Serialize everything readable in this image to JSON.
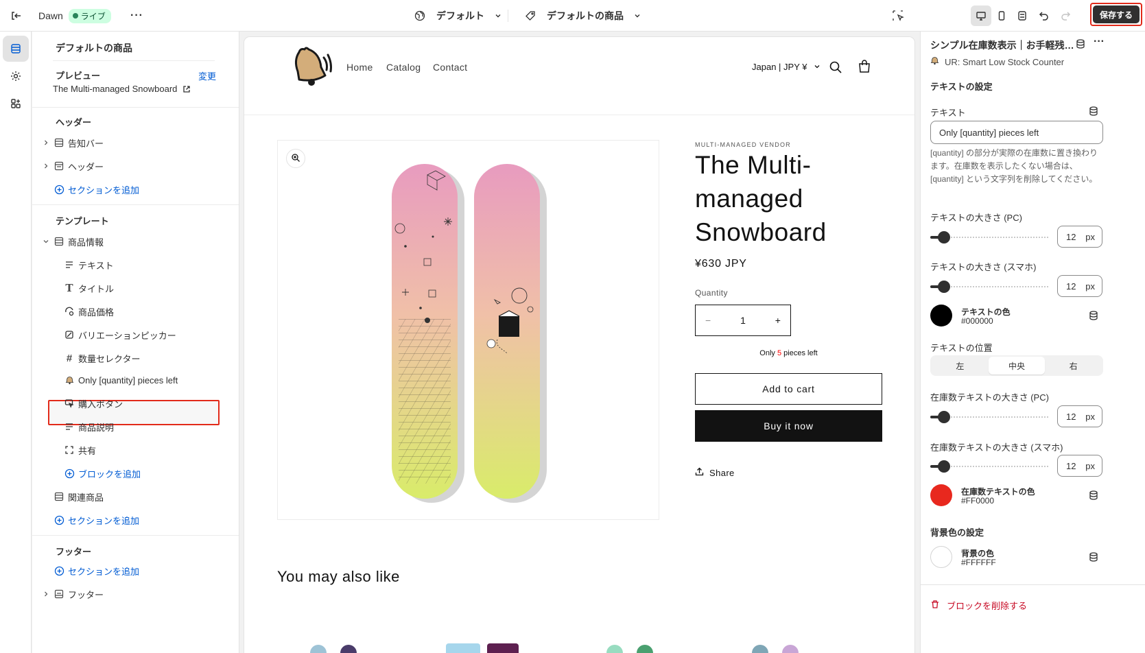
{
  "topbar": {
    "theme_name": "Dawn",
    "live_badge": "ライブ",
    "more_label": "···",
    "context_default": "デフォルト",
    "context_template": "デフォルトの商品",
    "save_label": "保存する"
  },
  "sidebar": {
    "title": "デフォルトの商品",
    "preview_heading": "プレビュー",
    "preview_change": "変更",
    "preview_product": "The Multi-managed Snowboard",
    "header_section": "ヘッダー",
    "header_items": [
      "告知バー",
      "ヘッダー"
    ],
    "add_section": "セクションを追加",
    "template_section": "テンプレート",
    "product_info": "商品情報",
    "blocks": [
      "テキスト",
      "タイトル",
      "商品価格",
      "バリエーションピッカー",
      "数量セレクター",
      "Only [quantity] pieces left",
      "購入ボタン",
      "商品説明",
      "共有"
    ],
    "add_block": "ブロックを追加",
    "related_products": "関連商品",
    "footer_section": "フッター",
    "footer_item": "フッター"
  },
  "store": {
    "nav_links": [
      "Home",
      "Catalog",
      "Contact"
    ],
    "currency": "Japan | JPY ¥",
    "vendor": "MULTI-MANAGED VENDOR",
    "title": "The Multi-managed Snowboard",
    "price": "¥630 JPY",
    "quantity_label": "Quantity",
    "quantity_value": "1",
    "minus": "−",
    "plus": "+",
    "stock_prefix": "Only ",
    "stock_count": "5",
    "stock_suffix": " pieces left",
    "add_to_cart": "Add to cart",
    "buy_now": "Buy it now",
    "share": "Share",
    "also_like": "You may also like"
  },
  "panel": {
    "title": "シンプル在庫数表示｜お手軽残…",
    "app_name": "UR: Smart Low Stock Counter",
    "text_settings": "テキストの設定",
    "text_label": "テキスト",
    "text_value": "Only [quantity] pieces left",
    "text_help": "[quantity] の部分が実際の在庫数に置き換わります。在庫数を表示したくない場合は、[quantity] という文字列を削除してください。",
    "size_pc_label": "テキストの大きさ (PC)",
    "size_pc_value": "12",
    "size_sp_label": "テキストの大きさ (スマホ)",
    "size_sp_value": "12",
    "unit": "px",
    "text_color_name": "テキストの色",
    "text_color_hex": "#000000",
    "position_label": "テキストの位置",
    "position_options": [
      "左",
      "中央",
      "右"
    ],
    "stock_size_pc_label": "在庫数テキストの大きさ (PC)",
    "stock_size_pc_value": "12",
    "stock_size_sp_label": "在庫数テキストの大きさ (スマホ)",
    "stock_size_sp_value": "12",
    "stock_color_name": "在庫数テキストの色",
    "stock_color_hex": "#FF0000",
    "bg_settings": "背景色の設定",
    "bg_color_name": "背景の色",
    "bg_color_hex": "#FFFFFF",
    "delete_block": "ブロックを削除する"
  },
  "colors": {
    "accent_link": "#005bd3",
    "save_button": "#303030",
    "highlight_border": "#e22a1a",
    "stock_color": "#FF0000",
    "text_color": "#000000",
    "bg_color": "#FFFFFF"
  }
}
